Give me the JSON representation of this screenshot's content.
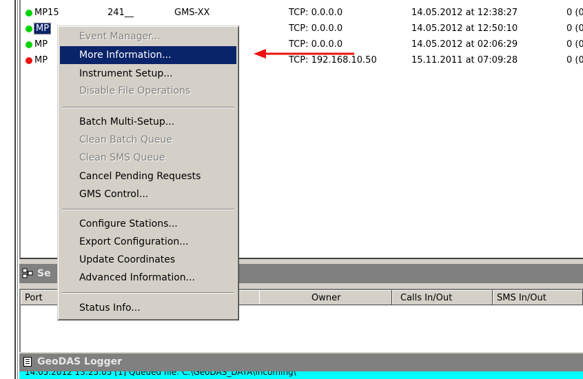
{
  "stations": [
    {
      "name": "MP15",
      "num": "241__",
      "gms": "GMS-XX",
      "tcp": "TCP: 0.0.0.0",
      "date": "14.05.2012 at 12:38:27",
      "last": "0 (0",
      "status_color": "#00d400"
    },
    {
      "name": "MP",
      "num": "",
      "gms": "",
      "tcp": "TCP: 0.0.0.0",
      "date": "14.05.2012 at 12:50:10",
      "last": "0 (0",
      "status_color": "#00d400"
    },
    {
      "name": "MP",
      "num": "",
      "gms": "",
      "tcp": "TCP: 0.0.0.0",
      "date": "14.05.2012 at 02:06:29",
      "last": "0 (0",
      "status_color": "#00d400"
    },
    {
      "name": "MP",
      "num": "",
      "gms": "",
      "tcp": "TCP: 192.168.10.50",
      "date": "15.11.2011 at 07:09:28",
      "last": "0 (0",
      "status_color": "#ee1111"
    }
  ],
  "context_menu": {
    "items": [
      {
        "label": "Event Manager...",
        "enabled": false
      },
      {
        "label": "More Information...",
        "enabled": true,
        "highlighted": true
      },
      {
        "label": "Instrument Setup...",
        "enabled": true
      },
      {
        "label": "Disable File Operations",
        "enabled": false
      },
      {
        "label": "Batch Multi-Setup...",
        "enabled": true
      },
      {
        "label": "Clean Batch Queue",
        "enabled": false
      },
      {
        "label": "Clean SMS Queue",
        "enabled": false
      },
      {
        "label": "Cancel Pending Requests",
        "enabled": true
      },
      {
        "label": "GMS Control...",
        "enabled": true
      },
      {
        "label": "Configure Stations...",
        "enabled": true
      },
      {
        "label": "Export Configuration...",
        "enabled": true
      },
      {
        "label": "Update Coordinates",
        "enabled": true
      },
      {
        "label": "Advanced Information...",
        "enabled": true
      },
      {
        "label": "Status Info...",
        "enabled": true
      }
    ]
  },
  "sessions_panel": {
    "title": "Se",
    "columns": [
      "Port",
      "Owner",
      "Calls In/Out",
      "SMS In/Out"
    ]
  },
  "logger": {
    "title": "GeoDAS Logger",
    "log_text": "14.05.2012 13:25:05 [1] Queued file: C:\\GeoDAS_DATA\\Incoming\\"
  },
  "colors": {
    "highlight": "#0a246a",
    "log_bg": "#00ffff",
    "arrow": "#ee1111",
    "title_bar": "#808080"
  }
}
